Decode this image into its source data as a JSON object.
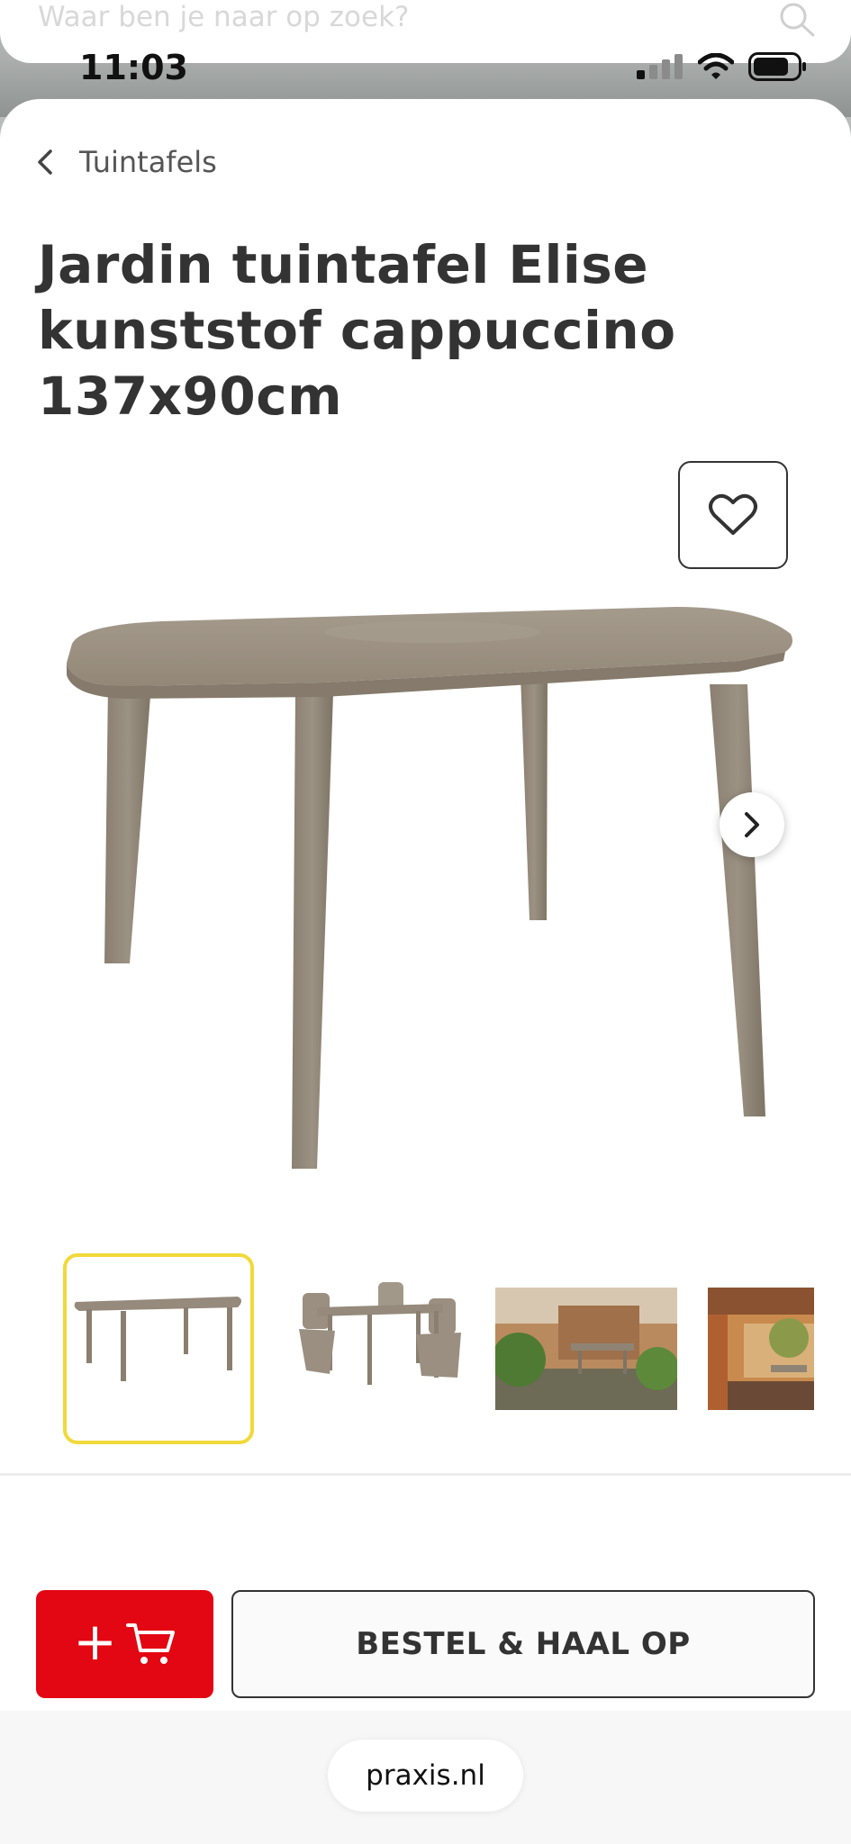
{
  "background_page": {
    "search_placeholder": "Waar ben je naar op zoek?"
  },
  "status_bar": {
    "time": "11:03"
  },
  "breadcrumb": {
    "label": "Tuintafels"
  },
  "product": {
    "title_line1": "Jardin tuintafel Elise",
    "title_line2": "kunststof cappuccino",
    "title_line3": "137x90cm"
  },
  "gallery": {
    "selected_index": 0,
    "thumbnail_count": 4
  },
  "actions": {
    "order_label": "BESTEL & HAAL OP"
  },
  "browser": {
    "url": "praxis.nl"
  },
  "colors": {
    "brand_red": "#e30613",
    "selected_thumb": "#f1d93a",
    "product_taupe": "#8f8474"
  }
}
